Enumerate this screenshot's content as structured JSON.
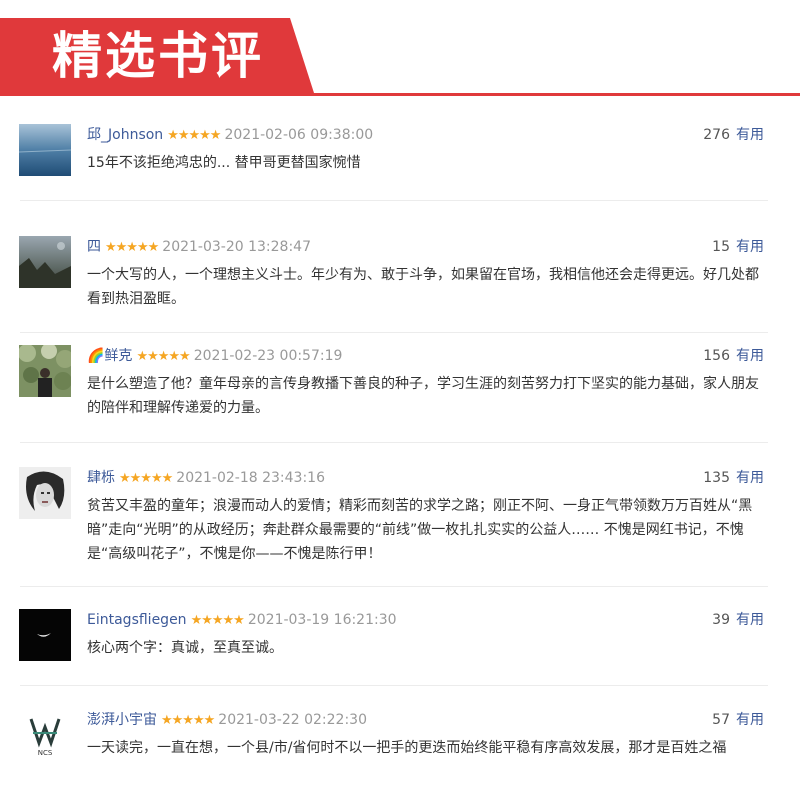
{
  "header": {
    "title": "精选书评",
    "accent_color": "#e0393b"
  },
  "reviews": [
    {
      "user": "邱_Johnson",
      "stars": "★★★★★",
      "date": "2021-02-06 09:38:00",
      "useful_count": "276",
      "useful_label": "有用",
      "text": "15年不该拒绝鸿忠的... 替甲哥更替国家惋惜",
      "avatar": "sea-photo"
    },
    {
      "user": "四",
      "stars": "★★★★★",
      "date": "2021-03-20 13:28:47",
      "useful_count": "15",
      "useful_label": "有用",
      "text": "一个大写的人，一个理想主义斗士。年少有为、敢于斗争，如果留在官场，我相信他还会走得更远。好几处都看到热泪盈眶。",
      "avatar": "tree-dusk-photo"
    },
    {
      "user": "🌈鲜克",
      "stars": "★★★★★",
      "date": "2021-02-23 00:57:19",
      "useful_count": "156",
      "useful_label": "有用",
      "text": "是什么塑造了他？童年母亲的言传身教播下善良的种子，学习生涯的刻苦努力打下坚实的能力基础，家人朋友的陪伴和理解传递爱的力量。",
      "avatar": "garden-person-photo"
    },
    {
      "user": "肆栎",
      "stars": "★★★★★",
      "date": "2021-02-18 23:43:16",
      "useful_count": "135",
      "useful_label": "有用",
      "text": "贫苦又丰盈的童年；浪漫而动人的爱情；精彩而刻苦的求学之路；刚正不阿、一身正气带领数万万百姓从“黑暗”走向“光明”的从政经历；奔赴群众最需要的“前线”做一枚扎扎实实的公益人…… 不愧是网红书记，不愧是“高级叫花子”，不愧是你——不愧是陈行甲！",
      "avatar": "portrait-sketch"
    },
    {
      "user": "Eintagsfliegen",
      "stars": "★★★★★",
      "date": "2021-03-19 16:21:30",
      "useful_count": "39",
      "useful_label": "有用",
      "text": "核心两个字：真诚，至真至诚。",
      "avatar": "crescent-moon"
    },
    {
      "user": "澎湃小宇宙",
      "stars": "★★★★★",
      "date": "2021-03-22 02:22:30",
      "useful_count": "57",
      "useful_label": "有用",
      "text": "一天读完，一直在想，一个县/市/省何时不以一把手的更迭而始终能平稳有序高效发展，那才是百姓之福",
      "avatar": "ncs-logo",
      "avatar_caption": "NCS"
    }
  ]
}
